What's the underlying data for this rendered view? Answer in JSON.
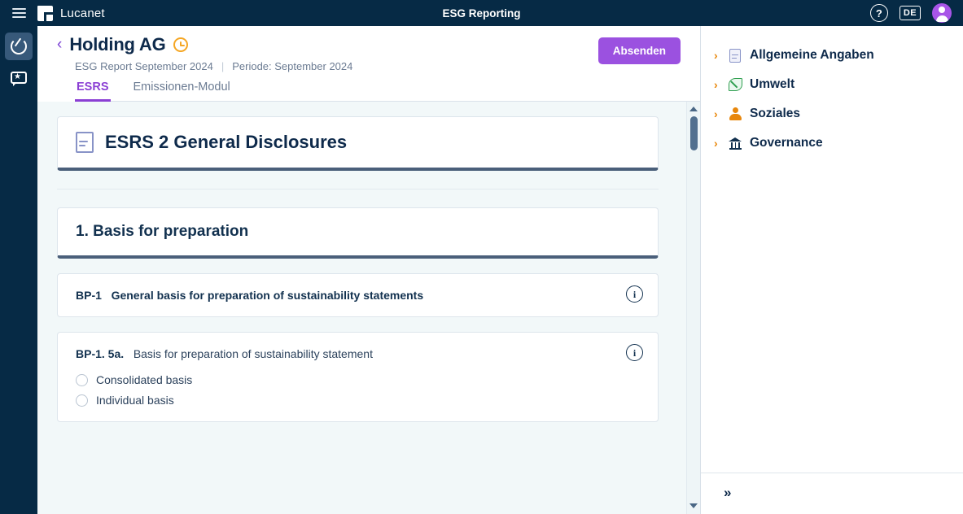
{
  "topbar": {
    "menu_icon": "hamburger-icon",
    "brand": "Lucanet",
    "title": "ESG Reporting",
    "help_icon": "?",
    "language": "DE",
    "avatar_icon": "user-avatar"
  },
  "rail": {
    "items": [
      {
        "icon": "eco-leaf-icon",
        "active": true
      },
      {
        "icon": "badge-star-icon",
        "active": false
      }
    ]
  },
  "header": {
    "back_icon": "‹",
    "title": "Holding AG",
    "status_icon": "clock-icon",
    "report_label": "ESG Report September 2024",
    "separator": "|",
    "period_label": "Periode: September 2024",
    "submit_label": "Absenden",
    "tabs": [
      {
        "label": "ESRS",
        "active": true
      },
      {
        "label": "Emissionen-Modul",
        "active": false
      }
    ]
  },
  "content": {
    "standard_card": {
      "icon": "document-icon",
      "title": "ESRS 2 General Disclosures"
    },
    "section_card": {
      "title": "1. Basis for preparation"
    },
    "questions": [
      {
        "code": "BP-1",
        "text": "General basis for preparation of sustainability statements",
        "info_icon": "i",
        "options": []
      },
      {
        "code": "BP-1. 5a.",
        "text": "Basis for preparation of sustainability statement",
        "info_icon": "i",
        "options": [
          {
            "label": "Consolidated basis",
            "selected": false
          },
          {
            "label": "Individual basis",
            "selected": false
          }
        ]
      }
    ]
  },
  "right_panel": {
    "items": [
      {
        "label": "Allgemeine Angaben",
        "icon": "document-icon",
        "chevron": "›",
        "expanded": false
      },
      {
        "label": "Umwelt",
        "icon": "leaf-icon",
        "chevron": "›",
        "expanded": false
      },
      {
        "label": "Soziales",
        "icon": "person-icon",
        "chevron": "›",
        "expanded": false
      },
      {
        "label": "Governance",
        "icon": "bank-icon",
        "chevron": "›",
        "expanded": false
      }
    ],
    "collapse_label": "»"
  },
  "colors": {
    "topbar_bg": "#062a45",
    "accent_purple": "#9b51e0",
    "tab_active": "#8b3fd4",
    "title_navy": "#0e2a4b",
    "chevron_orange": "#e8870c",
    "content_bg": "#f2f8f9"
  }
}
